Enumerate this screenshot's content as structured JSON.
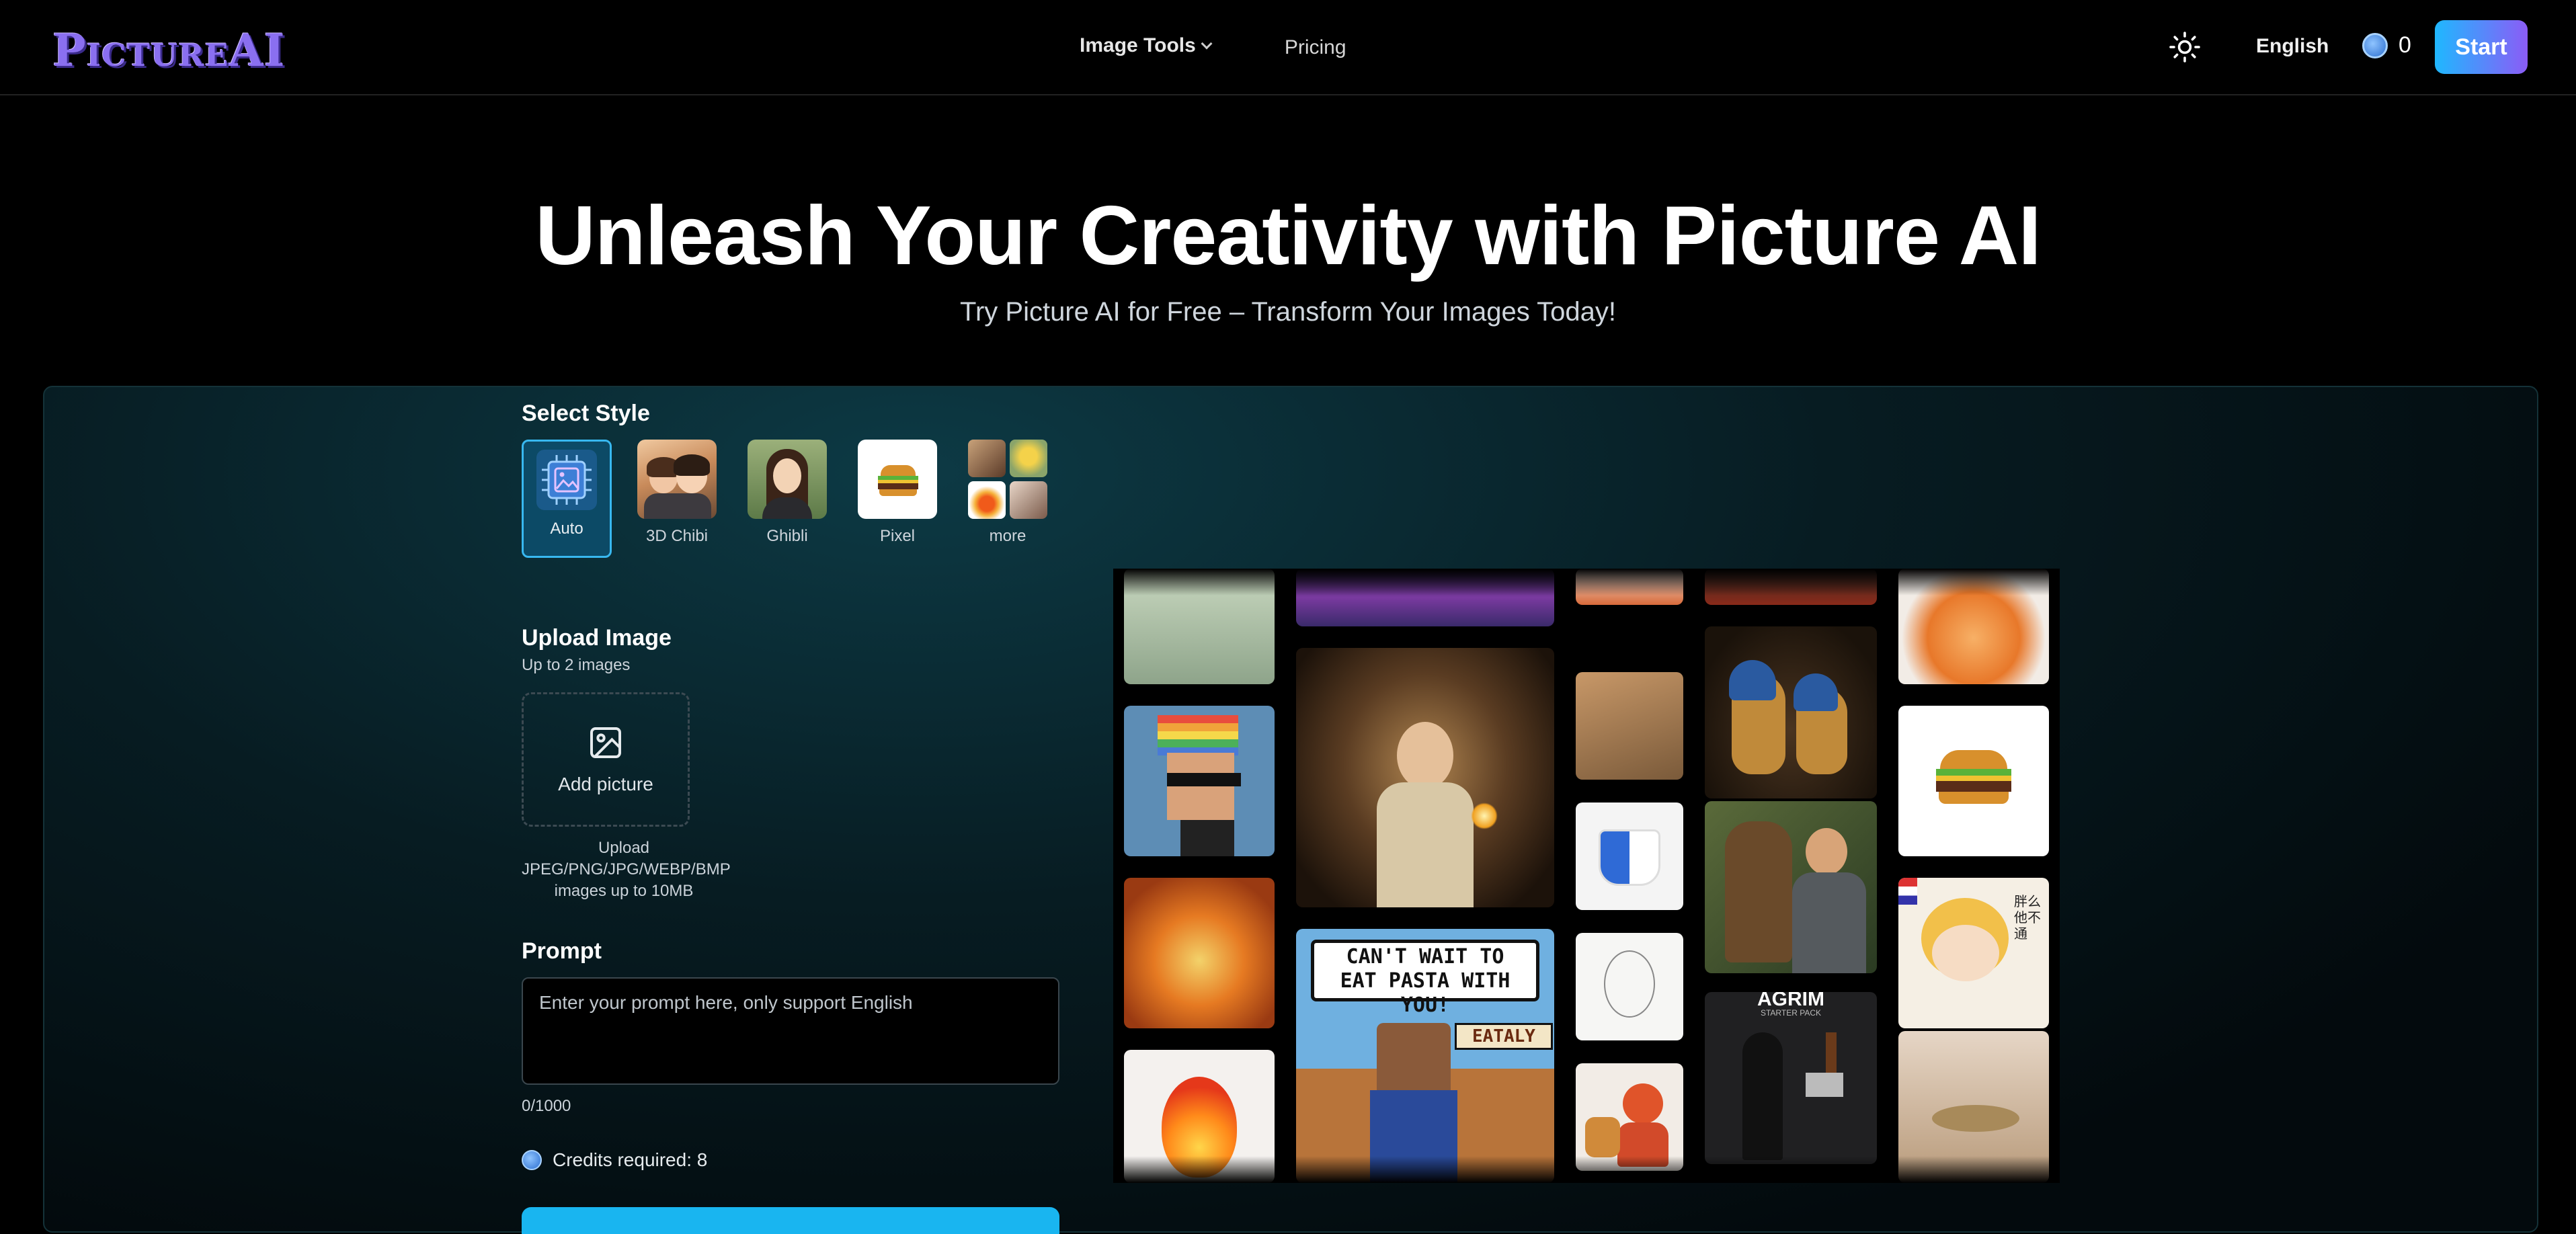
{
  "nav": {
    "logo": "PictureAI",
    "image_tools": "Image Tools",
    "pricing": "Pricing",
    "language": "English",
    "credits": "0",
    "start": "Start"
  },
  "hero": {
    "title": "Unleash Your Creativity with Picture AI",
    "subtitle": "Try Picture AI for Free – Transform Your Images Today!"
  },
  "style_section": {
    "title": "Select Style",
    "selected": "Auto",
    "styles": [
      {
        "label": "Auto"
      },
      {
        "label": "3D Chibi"
      },
      {
        "label": "Ghibli"
      },
      {
        "label": "Pixel"
      },
      {
        "label": "more"
      }
    ]
  },
  "upload": {
    "title": "Upload Image",
    "subtitle": "Up to 2 images",
    "button": "Add picture",
    "hint": "Upload JPEG/PNG/JPG/WEBP/BMP images up to 10MB"
  },
  "prompt": {
    "title": "Prompt",
    "placeholder": "Enter your prompt here, only support English",
    "value": "",
    "counter": "0/1000"
  },
  "credits_required": "Credits required: 8",
  "gallery": {
    "pixel_caption_top": "CAN'T WAIT TO EAT PASTA WITH YOU!",
    "pixel_caption_sign": "EATALY",
    "starter_pack_title": "AGRIM",
    "starter_pack_sub": "STARTER PACK",
    "comic_text": "胖么\n他不\n通"
  },
  "colors": {
    "accent": "#19b5f0",
    "start_gradient_from": "#1fb8ff",
    "start_gradient_to": "#8b5cf6",
    "logo": "#8a6ff0"
  },
  "icons": {
    "theme": "sun-icon",
    "credit": "coin-icon",
    "upload": "image-icon",
    "auto_style": "ai-chip-icon"
  }
}
